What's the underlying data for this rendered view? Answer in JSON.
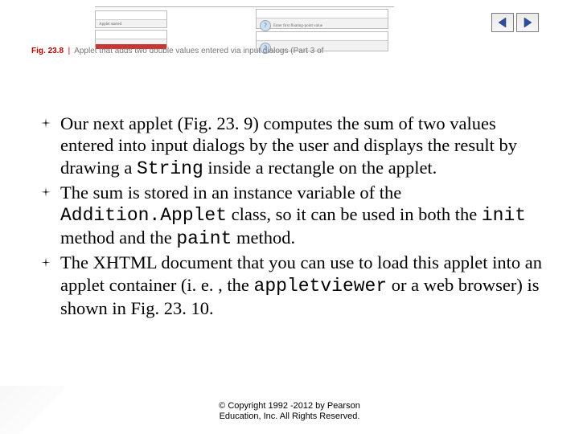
{
  "nav": {
    "prev": "previous-slide",
    "next": "next-slide"
  },
  "caption_num": "23.8",
  "caption_text": "Applet that adds two double values entered via input dialogs  (Part 3 of",
  "bullets": [
    {
      "segments": [
        {
          "t": "Our next applet (Fig. 23. 9) computes the sum of two values entered into input dialogs by the user and displays the result by drawing a "
        },
        {
          "t": "String",
          "mono": true
        },
        {
          "t": " inside a rectangle on the applet."
        }
      ]
    },
    {
      "segments": [
        {
          "t": "The sum is stored in an instance variable of the "
        },
        {
          "t": "Addition.Applet",
          "mono": true
        },
        {
          "t": " class, so it can be used in both the "
        },
        {
          "t": "init",
          "mono": true
        },
        {
          "t": " method and the "
        },
        {
          "t": "paint",
          "mono": true
        },
        {
          "t": " method."
        }
      ]
    },
    {
      "segments": [
        {
          "t": "The XHTML document that you can use to load this applet into an applet container (i. e. , the "
        },
        {
          "t": "appletviewer",
          "mono": true
        },
        {
          "t": " or a web browser) is shown in Fig. 23. 10."
        }
      ]
    }
  ],
  "footer": {
    "line1": "© Copyright 1992 -2012 by Pearson",
    "line2": "Education, Inc. All Rights Reserved."
  }
}
